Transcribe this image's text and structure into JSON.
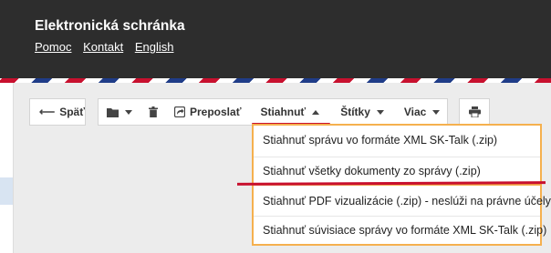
{
  "header": {
    "title": "Elektronická schránka",
    "nav": [
      "Pomoc",
      "Kontakt",
      "English"
    ]
  },
  "toolbar": {
    "back_label": "Späť",
    "forward_label": "Preposlať",
    "download_label": "Stiahnuť",
    "tags_label": "Štítky",
    "more_label": "Viac"
  },
  "download_menu": {
    "items": [
      "Stiahnuť správu vo formáte XML SK-Talk (.zip)",
      "Stiahnuť všetky dokumenty zo správy (.zip)",
      "Stiahnuť PDF vizualizácie (.zip) - neslúži na právne účely",
      "Stiahnuť súvisiace správy vo formáte XML SK-Talk (.zip)"
    ]
  },
  "colors": {
    "header_bg": "#2d2d2d",
    "stripe_red": "#c8102e",
    "stripe_blue": "#1f3c88",
    "highlight_orange": "#f5b04e"
  },
  "icons": [
    "arrow-left-icon",
    "folder-icon",
    "trash-icon",
    "share-icon",
    "printer-icon",
    "caret-down-icon",
    "caret-up-icon"
  ]
}
